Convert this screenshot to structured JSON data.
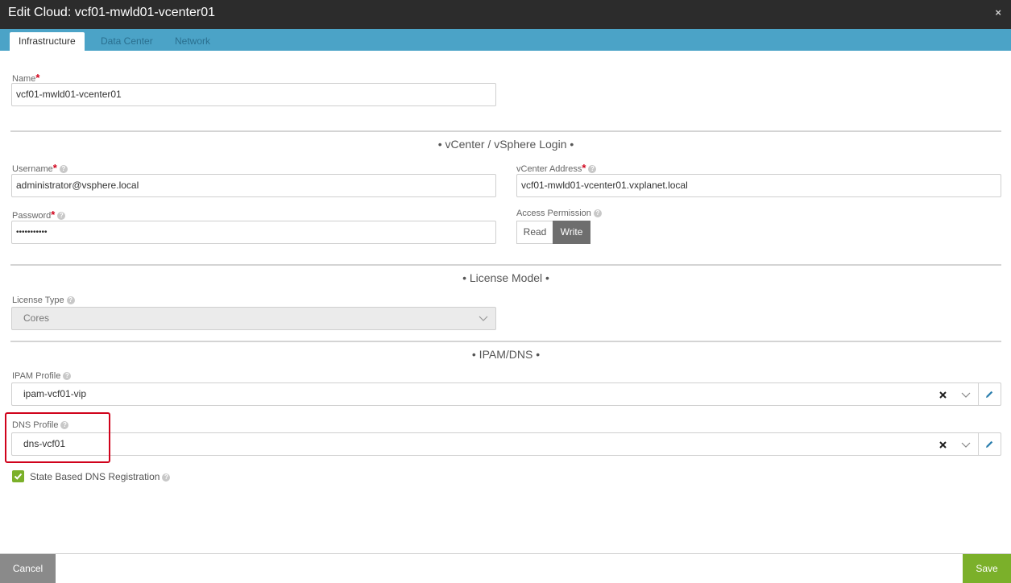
{
  "window": {
    "title": "Edit Cloud: vcf01-mwld01-vcenter01",
    "close_icon": "×"
  },
  "tabs": [
    {
      "label": "Infrastructure",
      "active": true
    },
    {
      "label": "Data Center",
      "active": false
    },
    {
      "label": "Network",
      "active": false
    }
  ],
  "name": {
    "label": "Name",
    "required": "*",
    "value": "vcf01-mwld01-vcenter01"
  },
  "sections": {
    "vcenter": "• vCenter / vSphere Login •",
    "license": "• License Model •",
    "ipam": "• IPAM/DNS •"
  },
  "username": {
    "label": "Username",
    "required": "*",
    "value": "administrator@vsphere.local"
  },
  "vcenter_address": {
    "label": "vCenter Address",
    "required": "*",
    "value": "vcf01-mwld01-vcenter01.vxplanet.local"
  },
  "password": {
    "label": "Password",
    "required": "*",
    "value": "•••••••••••"
  },
  "access_permission": {
    "label": "Access Permission",
    "options": [
      "Read",
      "Write"
    ],
    "selected": "Write"
  },
  "license_type": {
    "label": "License Type",
    "value": "Cores"
  },
  "ipam_profile": {
    "label": "IPAM Profile",
    "value": "ipam-vcf01-vip"
  },
  "dns_profile": {
    "label": "DNS Profile",
    "value": "dns-vcf01"
  },
  "state_dns": {
    "label": "State Based DNS Registration",
    "checked": true
  },
  "help_glyph": "?",
  "footer": {
    "cancel_label": "Cancel",
    "save_label": "Save"
  },
  "colors": {
    "accent": "#4ba3c7",
    "save": "#7bb02a",
    "required": "#d0021b",
    "highlight": "#d0021b"
  }
}
